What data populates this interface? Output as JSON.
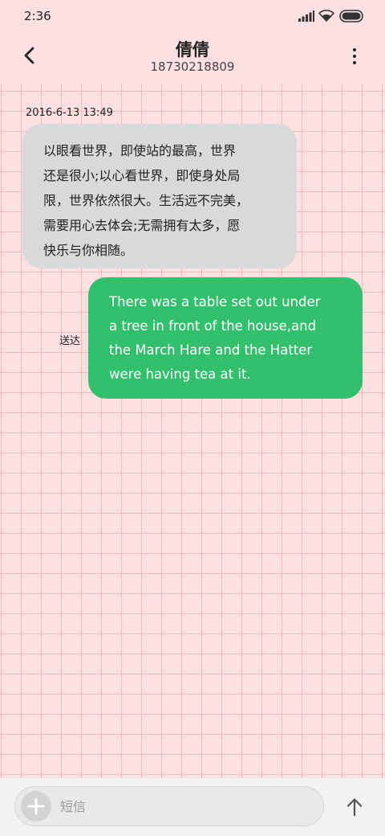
{
  "status_bar": {
    "time": "2:36",
    "icons": [
      "signal-icon",
      "wifi-icon",
      "battery-icon"
    ]
  },
  "header": {
    "contact_name": "倩倩",
    "phone_number": "18730218809",
    "back_icon": "chevron-left-icon",
    "menu_icon": "vertical-dots-icon"
  },
  "conversation": {
    "timestamp": "2016-6-13 13:49",
    "messages": [
      {
        "direction": "incoming",
        "lines": [
          "以眼看世界，即使站的最高，世界",
          "还是很小;以心看世界，即使身处局",
          "限，世界依然很大。生活远不完美，",
          "需要用心去体会;无需拥有太多，愿",
          "快乐与你相随。"
        ]
      },
      {
        "direction": "outgoing",
        "status": "送达",
        "lines": [
          "There was a table set out under",
          "a tree in front of the house,and",
          "the March Hare and the Hatter",
          "were having tea at it."
        ]
      }
    ]
  },
  "composer": {
    "placeholder": "短信",
    "plus_icon": "plus-icon",
    "send_icon": "arrow-up-icon"
  },
  "colors": {
    "background": "#fde1e2",
    "grid_line": "#ecb9bc",
    "incoming_bubble": "#d9d9d9",
    "outgoing_bubble": "#33c06d"
  }
}
